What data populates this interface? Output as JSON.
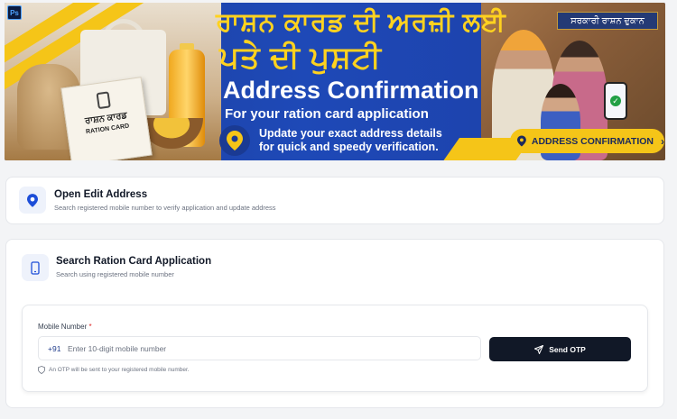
{
  "banner": {
    "ps_badge": "Ps",
    "punjabi_line1": "ਰਾਸ਼ਨ ਕਾਰਡ ਦੀ ਅਰਜ਼ੀ ਲਈ",
    "punjabi_line2": "ਪਤੇ ਦੀ ਪੁਸ਼ਟੀ",
    "title": "Address Confirmation",
    "subtitle": "For your ration card application",
    "desc_line1": "Update your exact address details",
    "desc_line2": "for quick and speedy verification.",
    "card_text_punjabi": "ਰਾਸ਼ਨ ਕਾਰਡ",
    "card_text": "RATION CARD",
    "shop_sign": "ਸਰਕਾਰੀ ਰਾਸ਼ਨ ਦੁਕਾਨ",
    "cta_label": "ADDRESS CONFIRMATION"
  },
  "edit_address": {
    "title": "Open Edit Address",
    "subtitle": "Search registered mobile number to verify application and update address"
  },
  "search_application": {
    "title": "Search Ration Card Application",
    "subtitle": "Search using registered mobile number"
  },
  "form": {
    "label": "Mobile Number",
    "required_mark": "*",
    "prefix": "+91",
    "placeholder": "Enter 10-digit mobile number",
    "value": "",
    "button_label": "Send OTP",
    "hint": "An OTP will be sent to your registered mobile number."
  },
  "colors": {
    "banner_blue": "#1e49b7",
    "accent_yellow": "#f5c518",
    "button_dark": "#111827",
    "icon_blue": "#1d4ed8"
  }
}
